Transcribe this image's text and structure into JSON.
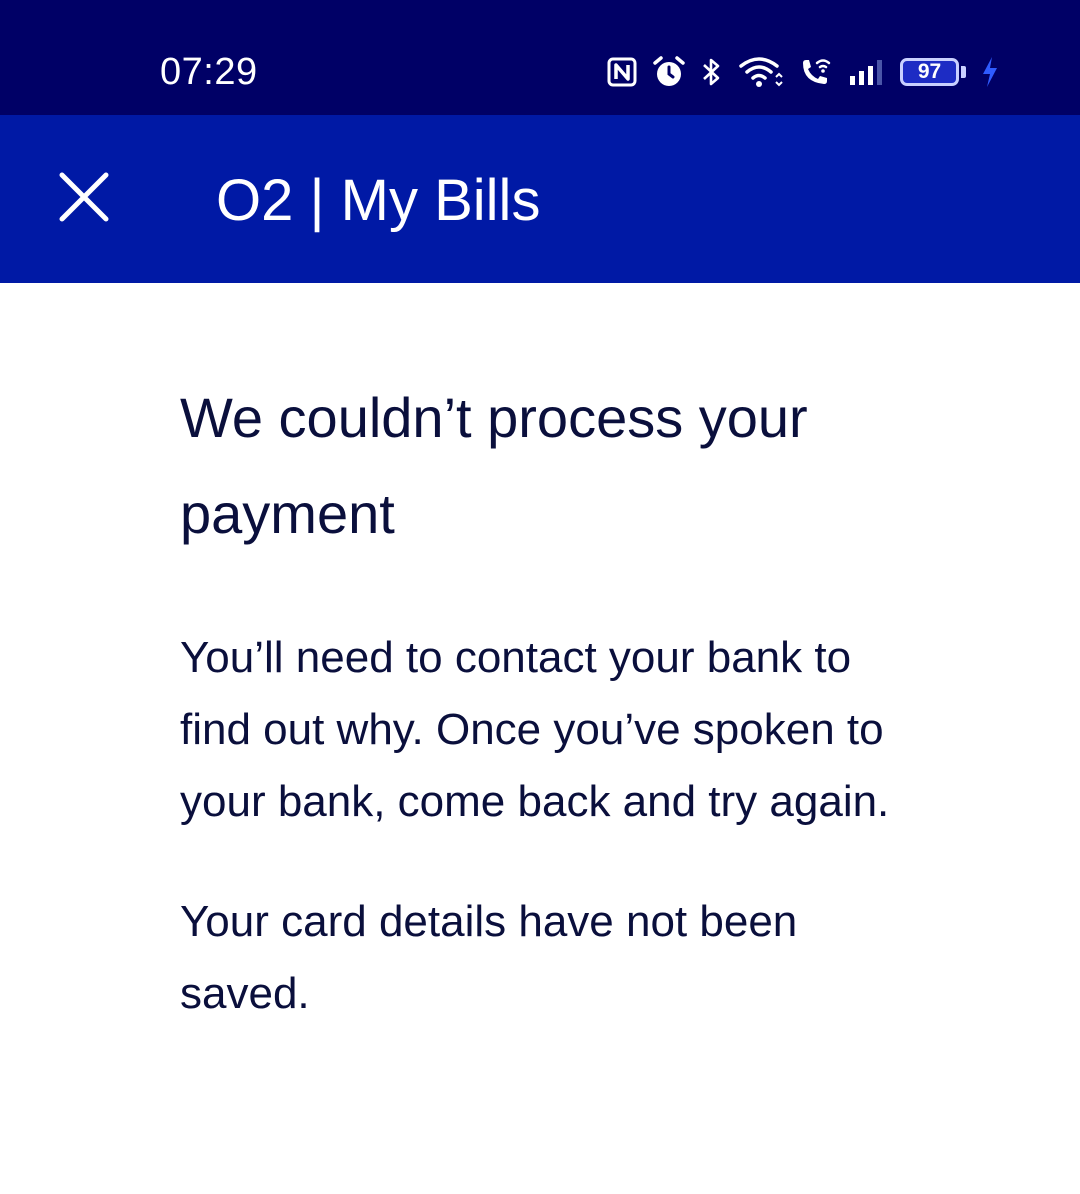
{
  "status_bar": {
    "time": "07:29",
    "icons": [
      "nfc-icon",
      "alarm-icon",
      "bluetooth-icon",
      "wifi-icon",
      "wifi-calling-icon",
      "signal-icon",
      "battery-icon",
      "charging-icon"
    ],
    "battery_level": "97",
    "background_color": "#000066"
  },
  "app_bar": {
    "title": "O2 | My Bills",
    "close_icon": "close-icon",
    "background_color": "#0019a5"
  },
  "main": {
    "heading": "We couldn’t process your payment",
    "paragraphs": [
      "You’ll need to contact your bank to find out why. Once you’ve spoken to your bank, come back and try again.",
      "Your card details have not been saved."
    ],
    "text_color": "#0a0f3c"
  }
}
